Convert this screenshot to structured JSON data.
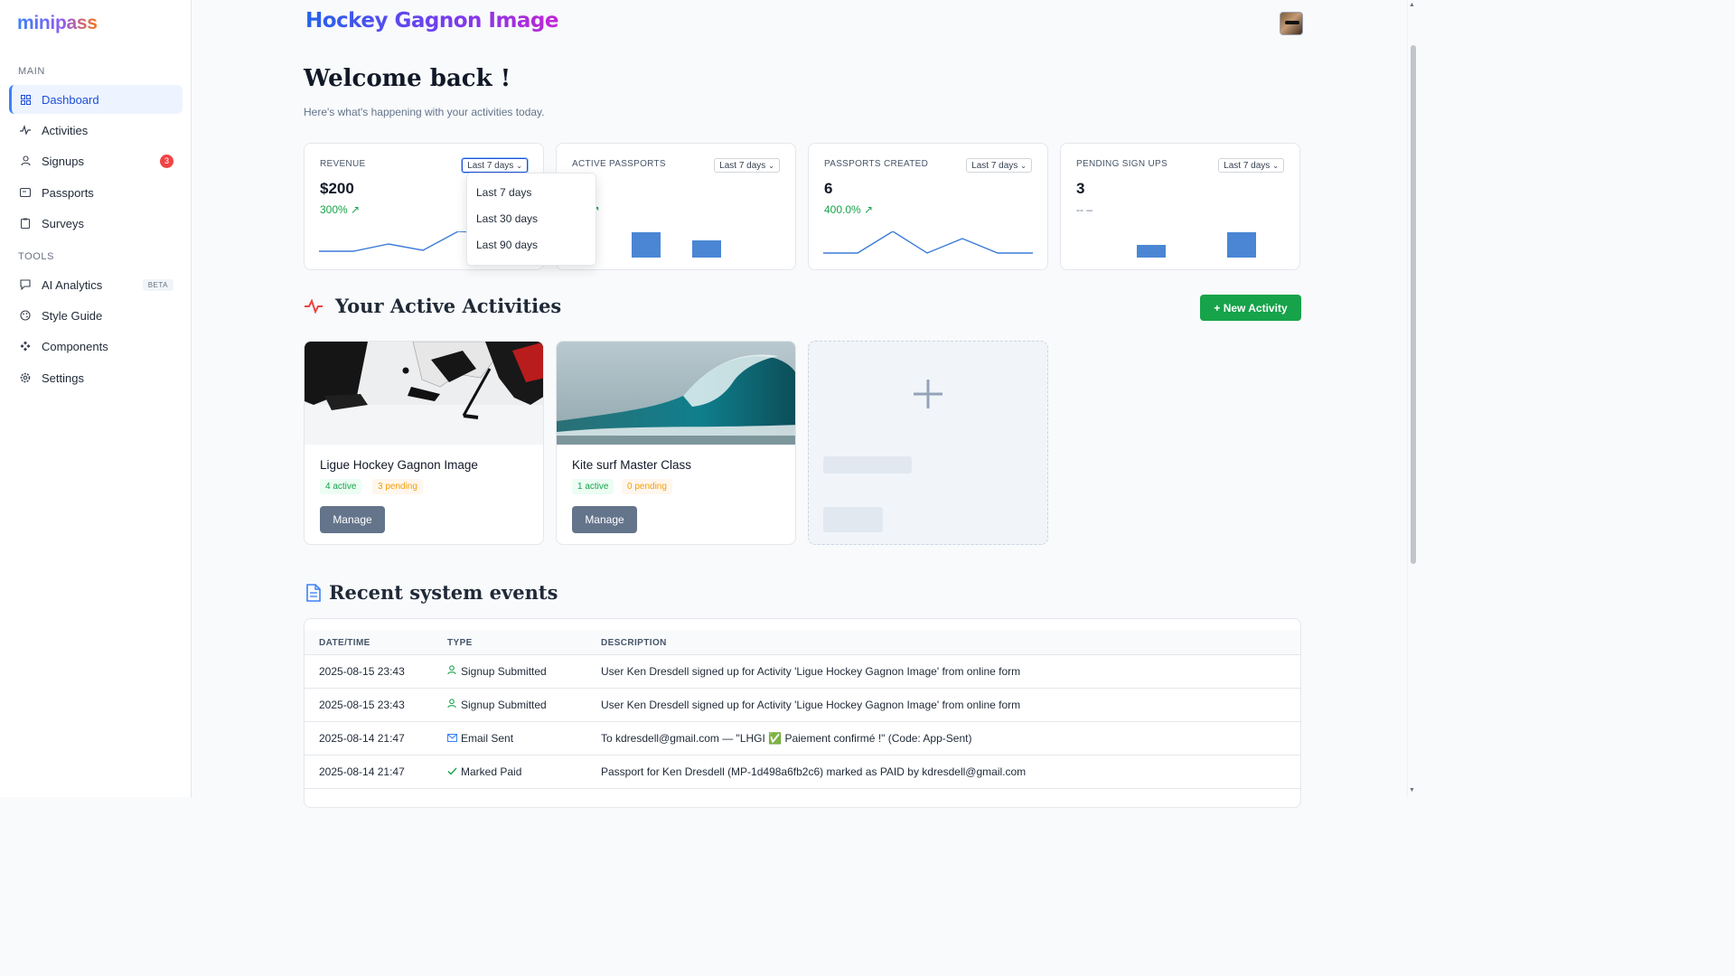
{
  "app": {
    "logo": "minipass",
    "brand_title": "Hockey Gagnon Image"
  },
  "sidebar": {
    "section_main": "MAIN",
    "section_tools": "TOOLS",
    "items": [
      {
        "label": "Dashboard",
        "icon": "dashboard-grid-icon",
        "active": true
      },
      {
        "label": "Activities",
        "icon": "activity-pulse-icon"
      },
      {
        "label": "Signups",
        "icon": "user-icon",
        "badge": "3"
      },
      {
        "label": "Passports",
        "icon": "passport-card-icon"
      },
      {
        "label": "Surveys",
        "icon": "clipboard-icon"
      }
    ],
    "tools": [
      {
        "label": "AI Analytics",
        "icon": "chat-icon",
        "badge": "BETA"
      },
      {
        "label": "Style Guide",
        "icon": "palette-icon"
      },
      {
        "label": "Components",
        "icon": "components-icon"
      },
      {
        "label": "Settings",
        "icon": "gear-icon"
      }
    ]
  },
  "header": {
    "welcome": "Welcome back !",
    "subtitle": "Here's what's happening with your activities today."
  },
  "stats": [
    {
      "label": "REVENUE",
      "period": "Last 7 days",
      "value": "$200",
      "trend": "300%",
      "trend_dir": "up",
      "chart": "line"
    },
    {
      "label": "ACTIVE PASSPORTS",
      "period": "Last 7 days",
      "value": "",
      "trend": "0%",
      "trend_dir": "up",
      "chart": "bar"
    },
    {
      "label": "PASSPORTS CREATED",
      "period": "Last 7 days",
      "value": "6",
      "trend": "400.0%",
      "trend_dir": "up",
      "chart": "line"
    },
    {
      "label": "PENDING SIGN UPS",
      "period": "Last 7 days",
      "value": "3",
      "trend": "-- –",
      "trend_dir": "none",
      "chart": "bar"
    }
  ],
  "period_dropdown": {
    "options": [
      "Last 7 days",
      "Last 30 days",
      "Last 90 days"
    ]
  },
  "activities": {
    "heading": "Your Active Activities",
    "new_button": "+ New Activity",
    "cards": [
      {
        "title": "Ligue Hockey Gagnon Image",
        "active": "4 active",
        "pending": "3 pending",
        "button": "Manage",
        "image": "hockey-players-on-ice"
      },
      {
        "title": "Kite surf Master Class",
        "active": "1 active",
        "pending": "0 pending",
        "button": "Manage",
        "image": "ocean-wave"
      }
    ],
    "add_card_icon": "plus-icon"
  },
  "events": {
    "heading": "Recent system events",
    "columns": [
      "DATE/TIME",
      "TYPE",
      "DESCRIPTION"
    ],
    "rows": [
      {
        "datetime": "2025-08-15 23:43",
        "type": "Signup Submitted",
        "icon": "user-icon",
        "description": "User Ken Dresdell signed up for Activity 'Ligue Hockey Gagnon Image' from online form"
      },
      {
        "datetime": "2025-08-15 23:43",
        "type": "Signup Submitted",
        "icon": "user-icon",
        "description": "User Ken Dresdell signed up for Activity 'Ligue Hockey Gagnon Image' from online form"
      },
      {
        "datetime": "2025-08-14 21:47",
        "type": "Email Sent",
        "icon": "envelope-icon",
        "description": "To kdresdell@gmail.com — \"LHGI ✅ Paiement confirmé !\" (Code: App-Sent)"
      },
      {
        "datetime": "2025-08-14 21:47",
        "type": "Marked Paid",
        "icon": "check-icon",
        "description": "Passport for Ken Dresdell (MP-1d498a6fb2c6) marked as PAID by kdresdell@gmail.com"
      }
    ]
  },
  "colors": {
    "accent": "#3b82f6",
    "success": "#16a34a",
    "warning": "#f59e0b",
    "danger": "#ef4444",
    "chart": "#4a86d4"
  }
}
